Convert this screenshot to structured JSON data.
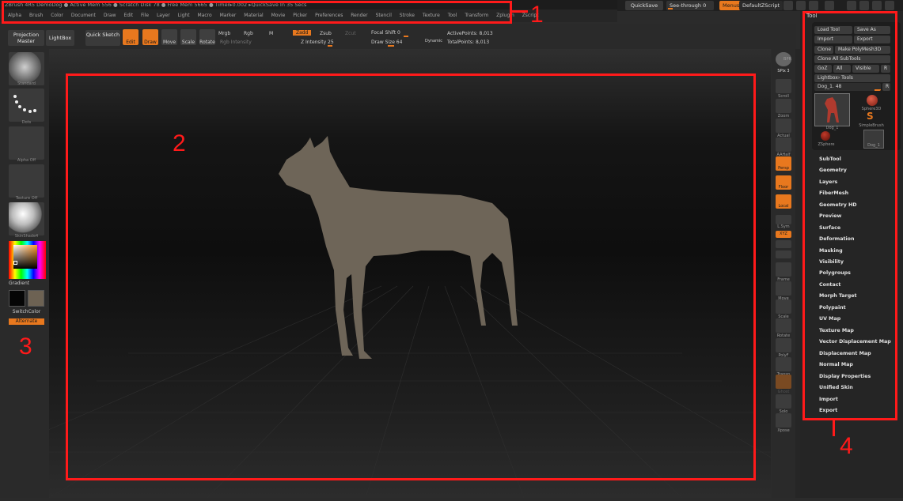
{
  "titlebar": {
    "text": "ZBrush 4R5   DemoDog   ● Active Mem 556 ● Scratch Disk 78 ● Free Mem 5665 ● Timer▸0.002  ▸QuickSave In 35 Secs"
  },
  "menubar": [
    "Alpha",
    "Brush",
    "Color",
    "Document",
    "Draw",
    "Edit",
    "File",
    "Layer",
    "Light",
    "Macro",
    "Marker",
    "Material",
    "Movie",
    "Picker",
    "Preferences",
    "Render",
    "Stencil",
    "Stroke",
    "Texture",
    "Tool",
    "Transform",
    "Zplugin",
    "Zscript"
  ],
  "topright": {
    "quicksave": "QuickSave",
    "seethrough": "See-through",
    "seethrough_val": "0",
    "menus": "Menus",
    "script": "DefaultZScript"
  },
  "toolbar": {
    "projection_master": "Projection Master",
    "lightbox": "LightBox",
    "quick_sketch": "Quick Sketch",
    "edit": "Edit",
    "draw": "Draw",
    "move": "Move",
    "scale": "Scale",
    "rotate": "Rotate",
    "mrgb": "Mrgb",
    "rgb": "Rgb",
    "m": "M",
    "rgb_intensity": "Rgb Intensity",
    "zadd": "Zadd",
    "zsub": "Zsub",
    "zcut": "Zcut",
    "z_intensity": "Z Intensity 25",
    "focal_shift": "Focal Shift 0",
    "draw_size": "Draw Size 64",
    "dynamic": "Dynamic",
    "active_points": "ActivePoints: 8,013",
    "total_points": "TotalPoints: 8,013"
  },
  "leftshelf": {
    "standard": "Standard",
    "dots": "Dots",
    "alpha_off": "Alpha Off",
    "texture_off": "Texture Off",
    "material": "SkinShade4",
    "gradient": "Gradient",
    "switchcolor": "SwitchColor",
    "alternate": "Alternate"
  },
  "rightshelf": [
    "BPR",
    "SPix 3",
    "Scroll",
    "Zoom",
    "Actual",
    "AAHalf",
    "Persp",
    "Floor",
    "Local",
    "L.Sym",
    "XYZ",
    "",
    "",
    "Frame",
    "Move",
    "Scale",
    "Rotate",
    "PolyF",
    "Transp",
    "Ghost",
    "Solo",
    "Xpose"
  ],
  "tool": {
    "title": "Tool",
    "load_tool": "Load Tool",
    "save_as": "Save As",
    "import": "Import",
    "export": "Export",
    "clone": "Clone",
    "make_polymesh": "Make PolyMesh3D",
    "clone_all": "Clone All SubTools",
    "goz": "GoZ",
    "all": "All",
    "visible": "Visible",
    "r": "R",
    "lightbox_tools": "Lightbox› Tools",
    "current_tool": "Dog_1. 48",
    "thumbs": [
      "Dog_1",
      "Sphere3D",
      "SimpleBrush",
      "ZSphere",
      "Dog_1"
    ],
    "items": [
      "SubTool",
      "Geometry",
      "Layers",
      "FiberMesh",
      "Geometry HD",
      "Preview",
      "Surface",
      "Deformation",
      "Masking",
      "Visibility",
      "Polygroups",
      "Contact",
      "Morph Target",
      "Polypaint",
      "UV Map",
      "Texture Map",
      "Vector Displacement Map",
      "Displacement Map",
      "Normal Map",
      "Display Properties",
      "Unified Skin",
      "Import",
      "Export"
    ]
  },
  "annotations": [
    "1",
    "2",
    "3",
    "4"
  ],
  "colors": {
    "accent": "#e8781e",
    "annotation": "#ff1a1a",
    "model": "#6e6558"
  }
}
